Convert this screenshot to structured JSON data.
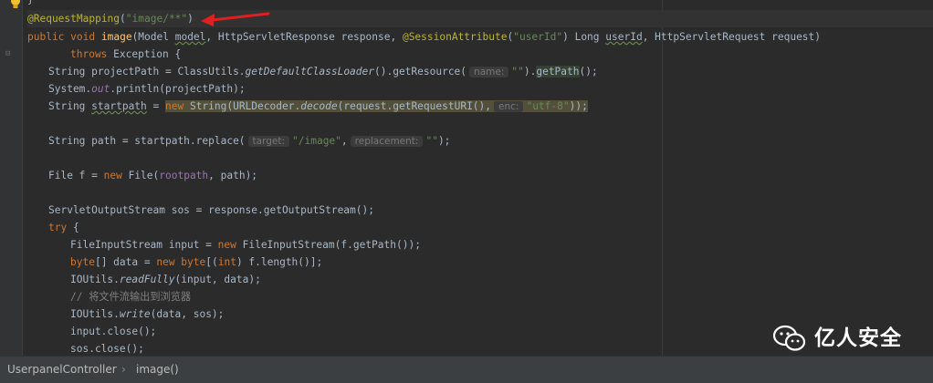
{
  "editor": {
    "brace_line": "}",
    "annotation": "@RequestMapping",
    "annotation_paren_open": "(",
    "annotation_value": "\"image/**\"",
    "annotation_paren_close": ")",
    "sig": {
      "kw_public": "public",
      "kw_void": "void",
      "name": "image",
      "p1": "(Model ",
      "model": "model",
      "p2": ", HttpServletResponse response, ",
      "session_ann": "@SessionAttribute",
      "p3": "(",
      "user_str": "\"userId\"",
      "p4": ") Long ",
      "userId": "userId",
      "p5": ", HttpServletRequest request)"
    },
    "throws_kw": "throws",
    "throws_rest": " Exception {",
    "l4": {
      "a": "String projectPath = ClassUtils.",
      "m1": "getDefaultClassLoader",
      "b": "().getResource(",
      "hint": "name:",
      "s": "\"\"",
      "c": ").",
      "m2": "getPath",
      "d": "();"
    },
    "l5": {
      "a": "System.",
      "f": "out",
      "b": ".println(projectPath);"
    },
    "l6": {
      "a": "String ",
      "v": "startpath",
      "b": " = ",
      "newkw": "new",
      "c": " String(URLDecoder.",
      "m": "decode",
      "d": "(request.getRequestURI(),",
      "hint": "enc:",
      "s": "\"utf-8\"",
      "e": "));"
    },
    "l8": {
      "a": "String path = startpath.replace(",
      "hint1": "target:",
      "s1": "\"/image\"",
      "comma": ",",
      "hint2": "replacement:",
      "s2": "\"\"",
      "b": ");"
    },
    "l10": {
      "a": "File f = ",
      "newkw": "new",
      "b": " File(",
      "f": "rootpath",
      "c": ", path);"
    },
    "l12": {
      "a": "ServletOutputStream sos = response.getOutputStream();"
    },
    "l13": {
      "kw": "try",
      "b": " {"
    },
    "l14": {
      "a": "FileInputStream input = ",
      "newkw": "new",
      "b": " FileInputStream(f.getPath());"
    },
    "l15": {
      "kw1": "byte",
      "a": "[] data = ",
      "newkw": "new",
      "kw2": "byte",
      "b": "[(",
      "kw3": "int",
      "c": ") f.length()];"
    },
    "l16": {
      "a": "IOUtils.",
      "m": "readFully",
      "b": "(input, data);"
    },
    "l17": {
      "comment": "// 将文件流输出到浏览器"
    },
    "l18": {
      "a": "IOUtils.",
      "m": "write",
      "b": "(data, sos);"
    },
    "l19": {
      "a": "input.close();"
    },
    "l20": {
      "a": "sos.close();"
    }
  },
  "breadcrumb": {
    "class_name": "UserpanelController",
    "separator": "›",
    "method": "image()"
  },
  "watermark": {
    "text": "亿人安全"
  },
  "icons": {
    "bulb": "lightbulb-icon",
    "arrow": "red-arrow-icon",
    "wechat": "wechat-icon"
  },
  "colors": {
    "background": "#2b2b2b",
    "keyword": "#cc7832",
    "string": "#6a8759",
    "annotation": "#bbb529",
    "method": "#ffc66d",
    "field": "#9876aa",
    "arrow": "#e02020"
  }
}
